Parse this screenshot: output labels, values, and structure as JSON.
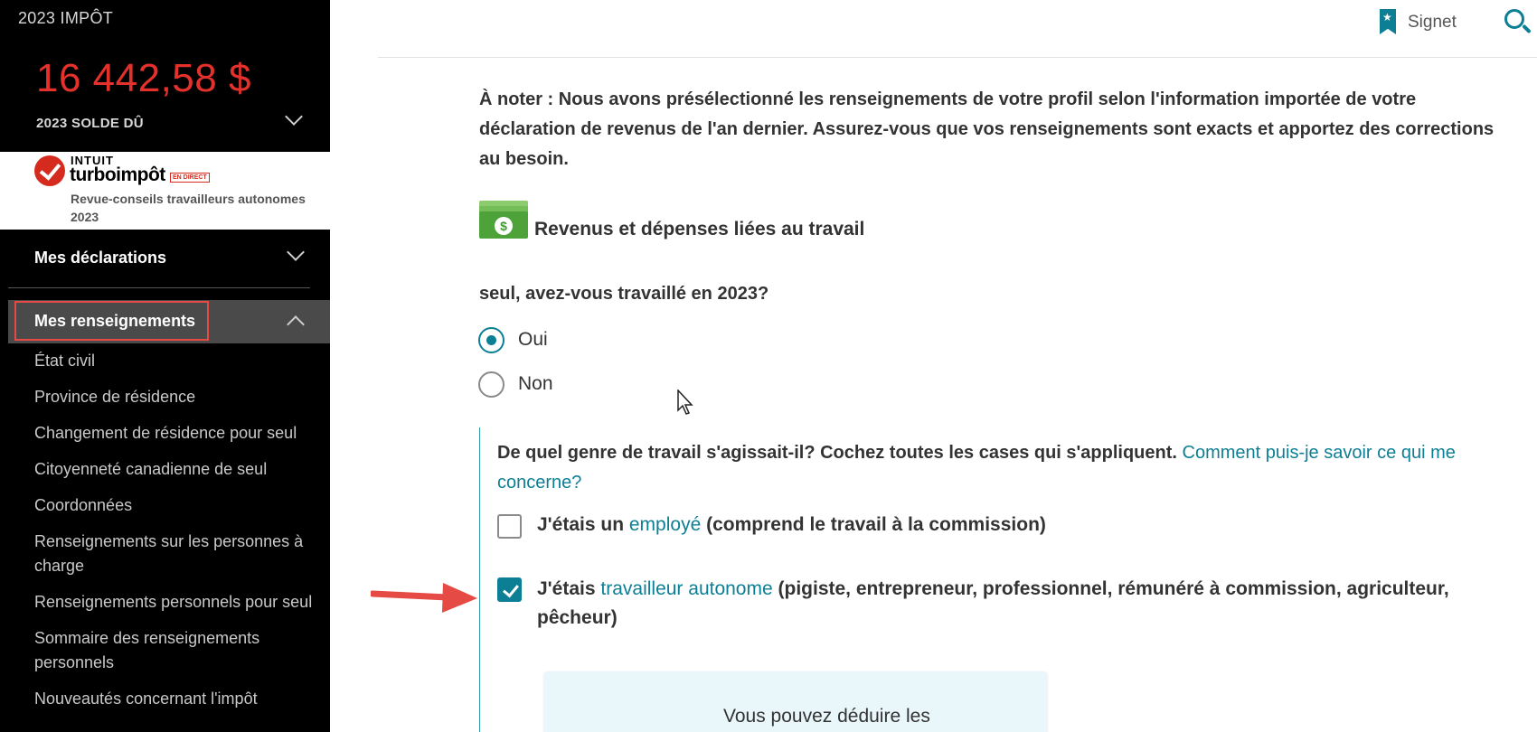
{
  "sidebar": {
    "tax_year": "2023 IMPÔT",
    "balance": "16 442,58 $",
    "balance_label": "2023 SOLDE DÛ",
    "brand": {
      "intuit": "INTUIT",
      "turbo": "turboimpôt",
      "live_badge": "EN DIRECT",
      "subtitle": "Revue-conseils travailleurs autonomes 2023"
    },
    "nav_declarations": "Mes déclarations",
    "nav_active": "Mes renseignements",
    "nav_items": [
      "État civil",
      "Province de résidence",
      "Changement de résidence pour seul",
      "Citoyenneté canadienne de seul",
      "Coordonnées",
      "Renseignements sur les personnes à charge",
      "Renseignements personnels pour seul",
      "Sommaire des renseignements personnels",
      "Nouveautés concernant l'impôt"
    ]
  },
  "topbar": {
    "bookmark_label": "Signet"
  },
  "main": {
    "note": "À noter : Nous avons présélectionné les renseignements de votre profil selon l'information importée de votre déclaration de revenus de l'an dernier. Assurez-vous que vos renseignements sont exacts et apportez des corrections au besoin.",
    "section_title": "Revenus et dépenses liées au travail",
    "question": "seul, avez-vous travaillé en 2023?",
    "radio_yes": "Oui",
    "radio_no": "Non",
    "sub_question": "De quel genre de travail s'agissait-il? Cochez toutes les cases qui s'appliquent.",
    "sub_question_link": "Comment puis-je savoir ce qui me concerne?",
    "cb_employee_pre": "J'étais un",
    "cb_employee_link": "employé",
    "cb_employee_post": "(comprend le travail à la commission)",
    "cb_self_pre": "J'étais",
    "cb_self_link": "travailleur autonome",
    "cb_self_post": "(pigiste, entrepreneur, professionnel, rémunéré à commission, agriculteur, pêcheur)",
    "info_card_text": "Vous pouvez déduire les"
  },
  "colors": {
    "accent": "#0d7f94",
    "balance": "#e4312b",
    "highlight_box": "#e64a45"
  }
}
